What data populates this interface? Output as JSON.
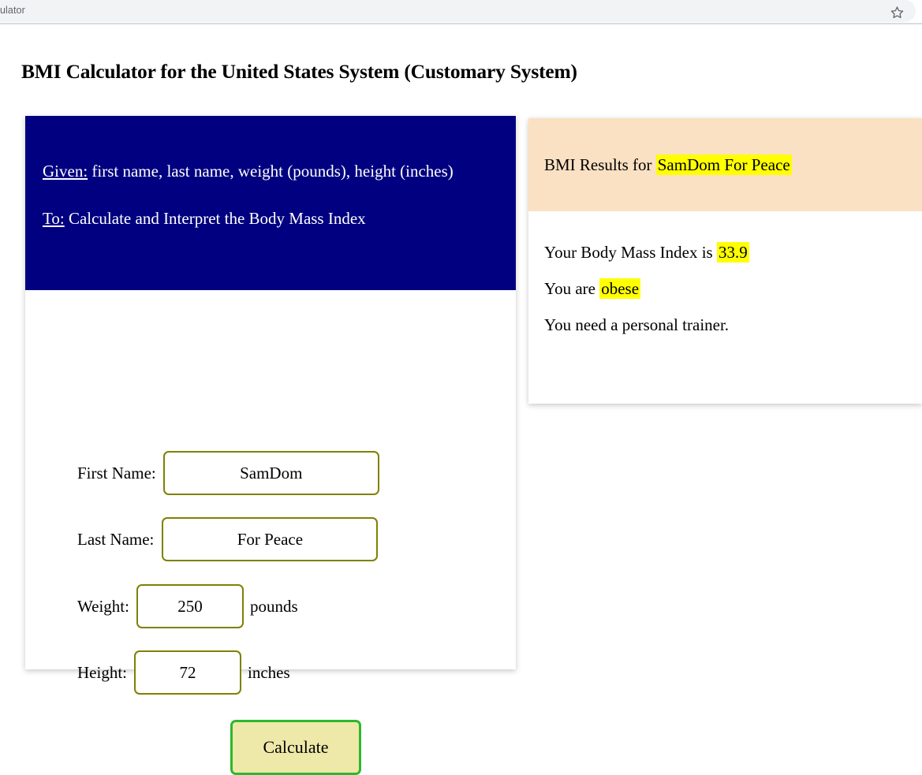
{
  "browser": {
    "tab_title": "ulator",
    "bookmark_icon": "star-icon"
  },
  "page": {
    "title": "BMI Calculator for the United States System (Customary System)"
  },
  "form_card": {
    "header": {
      "given_label": "Given:",
      "given_text": " first name, last name, weight (pounds), height (inches)",
      "to_label": "To:",
      "to_text": " Calculate and Interpret the Body Mass Index"
    },
    "fields": {
      "first_name": {
        "label": "First Name:",
        "value": "SamDom",
        "placeholder": ""
      },
      "last_name": {
        "label": "Last Name:",
        "value": "For Peace",
        "placeholder": ""
      },
      "weight": {
        "label": "Weight:",
        "value": "250",
        "unit": "pounds",
        "placeholder": ""
      },
      "height": {
        "label": "Height:",
        "value": "72",
        "unit": "inches",
        "placeholder": ""
      }
    },
    "calculate_label": "Calculate"
  },
  "results_card": {
    "header_prefix": "BMI Results for ",
    "header_name": "SamDom For Peace",
    "bmi_prefix": "Your Body Mass Index is ",
    "bmi_value": "33.9",
    "status_prefix": "You are ",
    "status_value": "obese",
    "advice": "You need a personal trainer."
  },
  "colors": {
    "navy": "#000080",
    "peach": "#FAE1C3",
    "highlight": "#FFFF00",
    "olive_border": "#808000",
    "button_fill": "#EEE8A9",
    "button_border": "#2DB82D"
  }
}
